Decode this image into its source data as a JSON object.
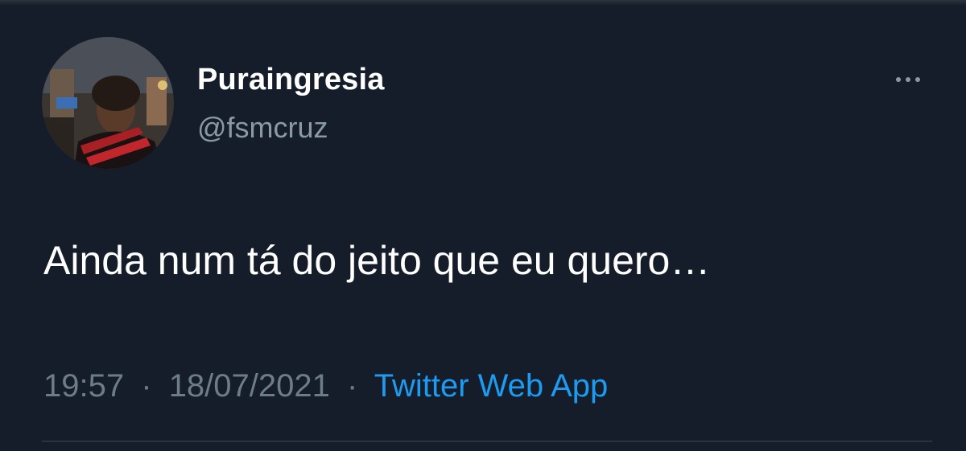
{
  "tweet": {
    "author": {
      "display_name": "Puraingresia",
      "handle": "@fsmcruz",
      "avatar_icon": "profile-photo"
    },
    "text": "Ainda num tá do jeito que eu quero…",
    "time": "19:57",
    "date": "18/07/2021",
    "separator": "·",
    "source": "Twitter Web App",
    "more_icon": "more-horizontal-icon"
  },
  "colors": {
    "background": "#141d29",
    "primary_text": "#ffffff",
    "secondary_text": "#8b98a5",
    "link": "#1d9bf0"
  }
}
